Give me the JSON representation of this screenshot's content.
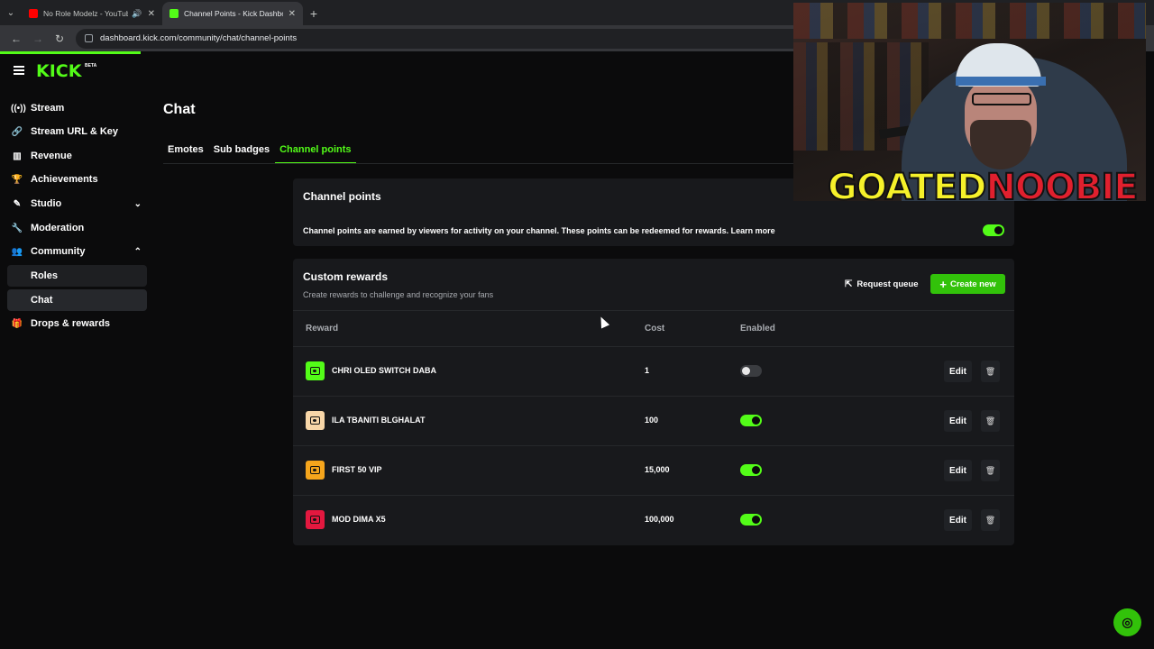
{
  "browser": {
    "tabs": [
      {
        "title": "No Role Modelz - YouTube",
        "favicon_color": "#ff0000",
        "active": false
      },
      {
        "title": "Channel Points - Kick Dashboard",
        "favicon_color": "#53fc18",
        "active": true
      }
    ],
    "url": "dashboard.kick.com/community/chat/channel-points"
  },
  "sidebar": {
    "logo": "KICK",
    "logo_badge": "BETA",
    "items": [
      {
        "label": "Stream",
        "icon": "broadcast-icon"
      },
      {
        "label": "Stream URL & Key",
        "icon": "link-icon"
      },
      {
        "label": "Revenue",
        "icon": "bar-chart-icon"
      },
      {
        "label": "Achievements",
        "icon": "trophy-icon"
      },
      {
        "label": "Studio",
        "icon": "edit-icon",
        "chevron": "down"
      },
      {
        "label": "Moderation",
        "icon": "wrench-icon"
      },
      {
        "label": "Community",
        "icon": "users-icon",
        "chevron": "up"
      },
      {
        "label": "Roles",
        "sub": true
      },
      {
        "label": "Chat",
        "sub": true,
        "active": true
      },
      {
        "label": "Drops & rewards",
        "icon": "gift-icon"
      }
    ]
  },
  "main": {
    "title": "Chat",
    "tabs": [
      {
        "label": "Emotes"
      },
      {
        "label": "Sub badges"
      },
      {
        "label": "Channel points",
        "active": true
      }
    ],
    "channel_points": {
      "heading": "Channel points",
      "description": "Channel points are earned by viewers for activity on your channel. These points can be redeemed for rewards. Learn more",
      "enabled": true
    },
    "custom_rewards": {
      "heading": "Custom rewards",
      "subtitle": "Create rewards to challenge and recognize your fans",
      "request_queue_label": "Request queue",
      "create_new_label": "Create new",
      "columns": {
        "reward": "Reward",
        "cost": "Cost",
        "enabled": "Enabled"
      },
      "rows": [
        {
          "name": "CHRI OLED SWITCH DABA",
          "cost": "1",
          "enabled": false,
          "color": "#53fc18",
          "edit_label": "Edit"
        },
        {
          "name": "ILA TBANITI BLGHALAT",
          "cost": "100",
          "enabled": true,
          "color": "#f7d6a8",
          "edit_label": "Edit"
        },
        {
          "name": "FIRST 50 VIP",
          "cost": "15,000",
          "enabled": true,
          "color": "#f5a51c",
          "edit_label": "Edit"
        },
        {
          "name": "MOD DIMA X5",
          "cost": "100,000",
          "enabled": true,
          "color": "#e3183f",
          "edit_label": "Edit"
        }
      ]
    }
  },
  "overlay": {
    "brand_part1": "GOATED",
    "brand_part2": "NOOBIE"
  },
  "colors": {
    "accent": "#53fc18",
    "button_green": "#32c20a",
    "background": "#0b0b0c",
    "card": "#18191c"
  }
}
